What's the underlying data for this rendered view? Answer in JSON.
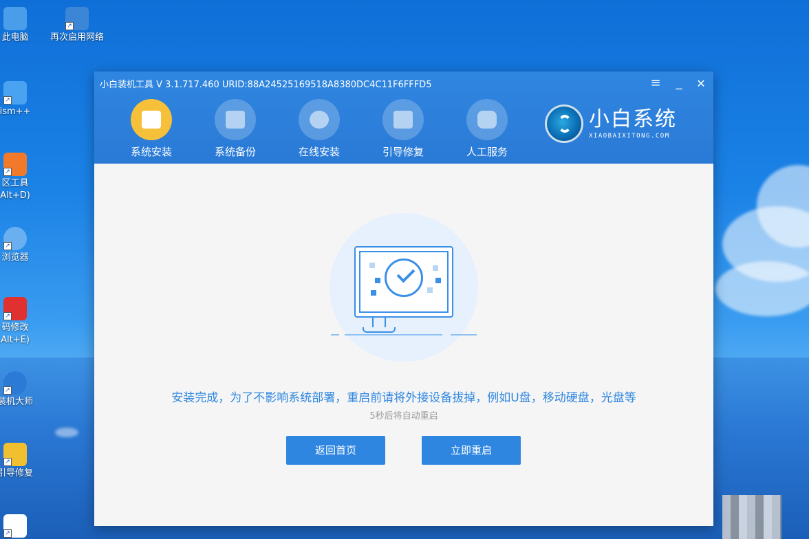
{
  "desktop": {
    "icons": [
      {
        "label": "此电脑",
        "color": "#4a9de8"
      },
      {
        "label": "再次启用网络",
        "color": "#3c86d8"
      },
      {
        "label": "ism++",
        "color": "#4aa3f0"
      },
      {
        "label": "区工具",
        "sub": "Alt+D)",
        "color": "#f07a2a"
      },
      {
        "label": "浏览器",
        "color": "#6ab0f0"
      },
      {
        "label": "码修改",
        "sub": "Alt+E)",
        "color": "#e03030"
      },
      {
        "label": "装机大师",
        "color": "#2a7ad6"
      },
      {
        "label": "引导修复",
        "color": "#f0c030"
      },
      {
        "label": "",
        "color": "#4a9de8"
      }
    ]
  },
  "window": {
    "title": "小白装机工具 V 3.1.717.460 URID:88A24525169518A8380DC4C11F6FFFD5",
    "controls": {
      "menu": "≡",
      "minimize": "_",
      "close": "✕"
    },
    "nav": [
      {
        "label": "系统安装",
        "active": true
      },
      {
        "label": "系统备份",
        "active": false
      },
      {
        "label": "在线安装",
        "active": false
      },
      {
        "label": "引导修复",
        "active": false
      },
      {
        "label": "人工服务",
        "active": false
      }
    ],
    "brand": {
      "name": "小白系统",
      "domain": "XIAOBAIXITONG.COM"
    },
    "message": "安装完成，为了不影响系统部署，重启前请将外接设备拔掉，例如U盘，移动硬盘，光盘等",
    "countdown": "5秒后将自动重启",
    "buttons": {
      "home": "返回首页",
      "restart": "立即重启"
    }
  },
  "colors": {
    "accent": "#2f86e0",
    "active_nav": "#f7c03a"
  }
}
